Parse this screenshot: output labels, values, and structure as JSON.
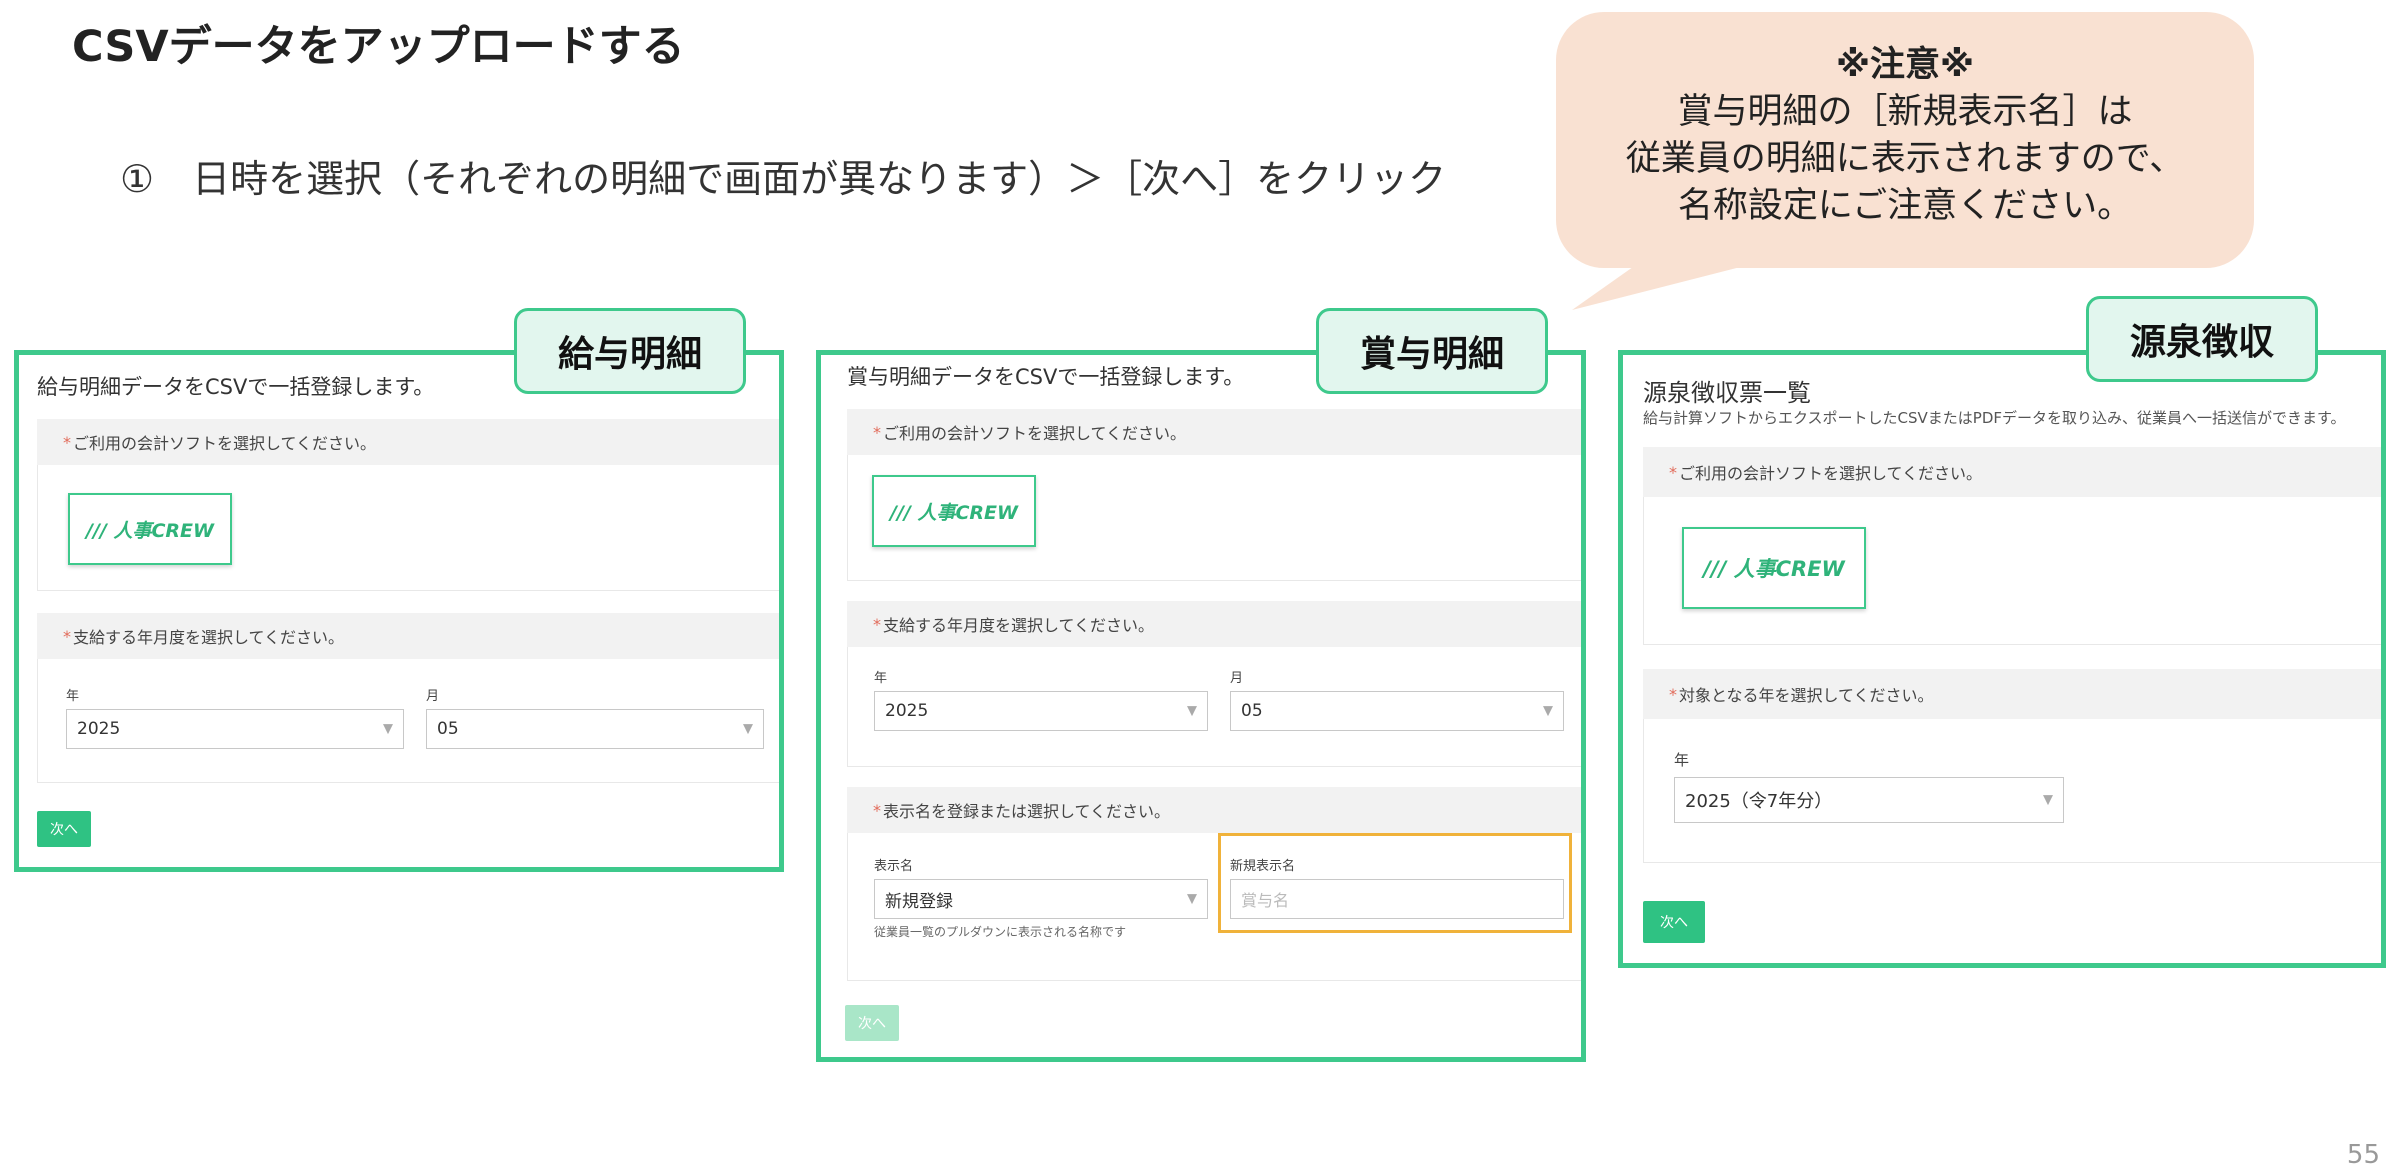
{
  "title": "CSVデータをアップロードする",
  "instruction": "①　日時を選択（それぞれの明細で画面が異なります）＞［次へ］をクリック",
  "callout": {
    "heading": "※注意※",
    "lines": [
      "賞与明細の［新規表示名］は",
      "従業員の明細に表示されますので、",
      "名称設定にご注意ください。"
    ]
  },
  "accent_color": "#3ec98c",
  "panels": {
    "salary": {
      "tag": "給与明細",
      "title": "給与明細データをCSVで一括登録します。",
      "software_label": "ご利用の会計ソフトを選択してください。",
      "logo": "/// 人事CREW",
      "period_label": "支給する年月度を選択してください。",
      "year_label": "年",
      "year_value": "2025",
      "month_label": "月",
      "month_value": "05",
      "next": "次へ"
    },
    "bonus": {
      "tag": "賞与明細",
      "title": "賞与明細データをCSVで一括登録します。",
      "software_label": "ご利用の会計ソフトを選択してください。",
      "logo": "/// 人事CREW",
      "period_label": "支給する年月度を選択してください。",
      "year_label": "年",
      "year_value": "2025",
      "month_label": "月",
      "month_value": "05",
      "display_section_label": "表示名を登録または選択してください。",
      "display_name_label": "表示名",
      "display_name_value": "新規登録",
      "display_name_hint": "従業員一覧のプルダウンに表示される名称です",
      "new_name_label": "新規表示名",
      "new_name_placeholder": "賞与名",
      "next": "次へ"
    },
    "withholding": {
      "tag": "源泉徴収",
      "title": "源泉徴収票一覧",
      "subtitle": "給与計算ソフトからエクスポートしたCSVまたはPDFデータを取り込み、従業員へ一括送信ができます。",
      "software_label": "ご利用の会計ソフトを選択してください。",
      "logo": "/// 人事CREW",
      "year_section_label": "対象となる年を選択してください。",
      "year_label": "年",
      "year_value": "2025（令7年分）",
      "next": "次へ"
    }
  },
  "page_number": "55"
}
